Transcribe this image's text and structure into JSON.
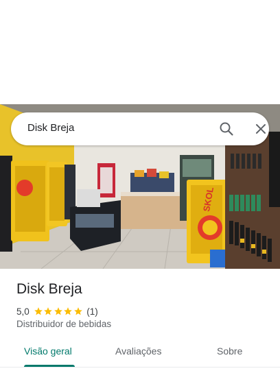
{
  "search": {
    "query": "Disk Breja"
  },
  "photo": {
    "description_icon": "store-interior-photo",
    "signage": "SKOL"
  },
  "place": {
    "name": "Disk Breja",
    "rating": "5,0",
    "stars": 5,
    "review_count": "(1)",
    "category": "Distribuidor de bebidas"
  },
  "tabs": [
    {
      "label": "Visão geral",
      "active": true
    },
    {
      "label": "Avaliações",
      "active": false
    },
    {
      "label": "Sobre",
      "active": false
    }
  ],
  "colors": {
    "accent": "#00796b",
    "star": "#fbbc04"
  }
}
